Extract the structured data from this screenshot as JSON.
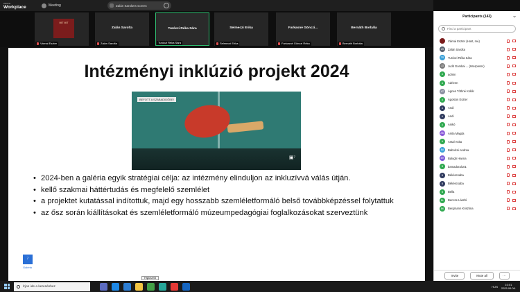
{
  "topbar": {
    "app_line1": "zoom",
    "app_line2": "Workplace",
    "meeting_label": "Meeting",
    "share_text": "Zalán Sarolta's screen"
  },
  "strip": {
    "tiles": [
      {
        "name": "",
        "label": "Várnai Eszter",
        "photo_text": "MIT MIT"
      },
      {
        "name": "Zalán Sarolta",
        "label": "Zalán Sarolta"
      },
      {
        "name": "Turóczi Réka Sára",
        "label": "Turóczi Réka Sára"
      },
      {
        "name": "Selmeczi Erika",
        "label": "Selmeczi Erika"
      },
      {
        "name": "Farkasné Gönczi...",
        "label": "Farkasné Gönczi Réka"
      },
      {
        "name": "Bernáth Borbála",
        "label": "Bernáth Borbála"
      }
    ]
  },
  "slide": {
    "title": "Intézményi inklúzió projekt 2024",
    "photo_tag": "BEFOTT A SZABADIDŐBE!",
    "photo_mark": "▣⁷",
    "bullets": [
      "2024-ben a galéria egyik stratégiai célja: az intézmény elinduljon az inkluzívvá válás útján.",
      "kellő szakmai háttértudás és megfelelő szemlélet",
      "a projektet kutatással indítottuk, majd egy hosszabb szemléletformáló belső továbbképzéssel folytattuk",
      "az ősz során kiállításokat és szemléletformáló múzeumpedagógiai foglalkozásokat szerveztünk"
    ],
    "logo_mark": "⁷",
    "logo_text": "Galéria"
  },
  "panel": {
    "title": "Participants (143)",
    "search_placeholder": "Find a participant",
    "participants": [
      {
        "initials": "",
        "name": "Várnai Eszter (Host, me)",
        "color": "#7b1c1c"
      },
      {
        "initials": "ZS",
        "name": "Zalán Sarolta",
        "color": "#5a6472"
      },
      {
        "initials": "TR",
        "name": "Turóczi Réka Sára",
        "color": "#3aa0d8"
      },
      {
        "initials": "JG",
        "name": "Judit Gombai ... (Interpreter)",
        "color": "#7a7a7a"
      },
      {
        "initials": "A",
        "name": "admin",
        "color": "#2fa84f"
      },
      {
        "initials": "A",
        "name": "Adrienn",
        "color": "#2fa84f"
      },
      {
        "initials": "AT",
        "name": "Ágnes Tóthné Kollár",
        "color": "#8a8fa0"
      },
      {
        "initials": "A",
        "name": "Ágoston Eszter",
        "color": "#2fa84f"
      },
      {
        "initials": "A",
        "name": "Andi",
        "color": "#2f3a5e"
      },
      {
        "initials": "A",
        "name": "Andi",
        "color": "#2f3a5e"
      },
      {
        "initials": "A",
        "name": "Anikó",
        "color": "#2fa84f"
      },
      {
        "initials": "AM",
        "name": "Anita Magda",
        "color": "#8a5ad8"
      },
      {
        "initials": "A",
        "name": "Antal Anita",
        "color": "#2fa84f"
      },
      {
        "initials": "BA",
        "name": "Babolcsi Andrea",
        "color": "#3aa0d8"
      },
      {
        "initials": "BH",
        "name": "Balogh Hanna",
        "color": "#7a5ad8"
      },
      {
        "initials": "B",
        "name": "bamadoral101",
        "color": "#2fa84f"
      },
      {
        "initials": "B",
        "name": "Békéscsaba",
        "color": "#2f3a5e"
      },
      {
        "initials": "B",
        "name": "Békéscsaba",
        "color": "#2f3a5e"
      },
      {
        "initials": "B",
        "name": "Bella",
        "color": "#2fa84f"
      },
      {
        "initials": "BL",
        "name": "Bencze László",
        "color": "#2fa84f"
      },
      {
        "initials": "BK",
        "name": "Bergmann Krisztina",
        "color": "#2fa84f"
      }
    ],
    "invite_label": "Invite",
    "mute_all_label": "Mute all",
    "more_label": "···"
  },
  "taskbar": {
    "search_placeholder": "Írjon ide a kereséshez",
    "tooltip": "Fájlkezelő",
    "lang": "HUN",
    "time": "10:01",
    "date": "2025.06.06."
  }
}
